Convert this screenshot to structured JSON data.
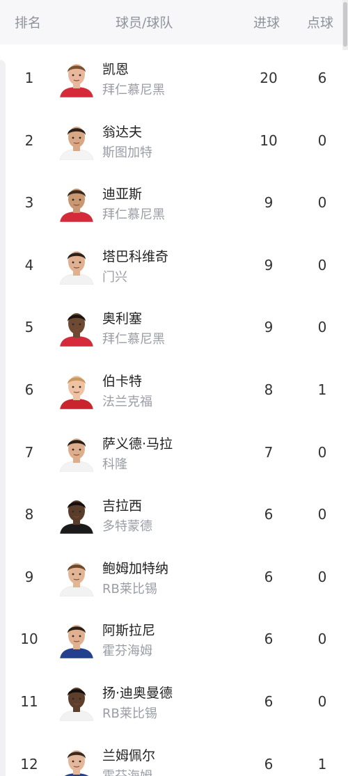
{
  "header": {
    "rank": "排名",
    "player_team": "球员/球队",
    "goals": "进球",
    "penalties": "点球"
  },
  "rows": [
    {
      "rank": "1",
      "name": "凯恩",
      "team": "拜仁慕尼黑",
      "goals": "20",
      "pens": "6",
      "kit": "#d52a3a",
      "hair": "#7a5230",
      "skin": "#e9b79c"
    },
    {
      "rank": "2",
      "name": "翁达夫",
      "team": "斯图加特",
      "goals": "10",
      "pens": "0",
      "kit": "#f4f4f4",
      "hair": "#2b2118",
      "skin": "#d9a783"
    },
    {
      "rank": "3",
      "name": "迪亚斯",
      "team": "拜仁慕尼黑",
      "goals": "9",
      "pens": "0",
      "kit": "#d52a3a",
      "hair": "#3a2a1e",
      "skin": "#c99873"
    },
    {
      "rank": "4",
      "name": "塔巴科维奇",
      "team": "门兴",
      "goals": "9",
      "pens": "0",
      "kit": "#f2f2f2",
      "hair": "#2a211a",
      "skin": "#e0b090"
    },
    {
      "rank": "5",
      "name": "奥利塞",
      "team": "拜仁慕尼黑",
      "goals": "9",
      "pens": "0",
      "kit": "#d52a3a",
      "hair": "#1c1410",
      "skin": "#6e4a33"
    },
    {
      "rank": "6",
      "name": "伯卡特",
      "team": "法兰克福",
      "goals": "8",
      "pens": "1",
      "kit": "#c9252f",
      "hair": "#c89a60",
      "skin": "#efc2a4"
    },
    {
      "rank": "7",
      "name": "萨义德·马拉",
      "team": "科隆",
      "goals": "7",
      "pens": "0",
      "kit": "#f3f3f3",
      "hair": "#2a1f18",
      "skin": "#deae8c"
    },
    {
      "rank": "8",
      "name": "吉拉西",
      "team": "多特蒙德",
      "goals": "6",
      "pens": "0",
      "kit": "#1b1b1b",
      "hair": "#151010",
      "skin": "#5a3c2a"
    },
    {
      "rank": "9",
      "name": "鲍姆加特纳",
      "team": "RB莱比锡",
      "goals": "6",
      "pens": "0",
      "kit": "#f2f2f2",
      "hair": "#6b4a2c",
      "skin": "#e4b594"
    },
    {
      "rank": "10",
      "name": "阿斯拉尼",
      "team": "霍芬海姆",
      "goals": "6",
      "pens": "0",
      "kit": "#23408f",
      "hair": "#2b2018",
      "skin": "#e0b091"
    },
    {
      "rank": "11",
      "name": "扬·迪奥曼德",
      "team": "RB莱比锡",
      "goals": "6",
      "pens": "0",
      "kit": "#f2f2f2",
      "hair": "#151010",
      "skin": "#5d3f2c"
    },
    {
      "rank": "12",
      "name": "兰姆佩尔",
      "team": "霍芬海姆",
      "goals": "6",
      "pens": "1",
      "kit": "#23408f",
      "hair": "#3a2a1e",
      "skin": "#e4b79a"
    }
  ]
}
